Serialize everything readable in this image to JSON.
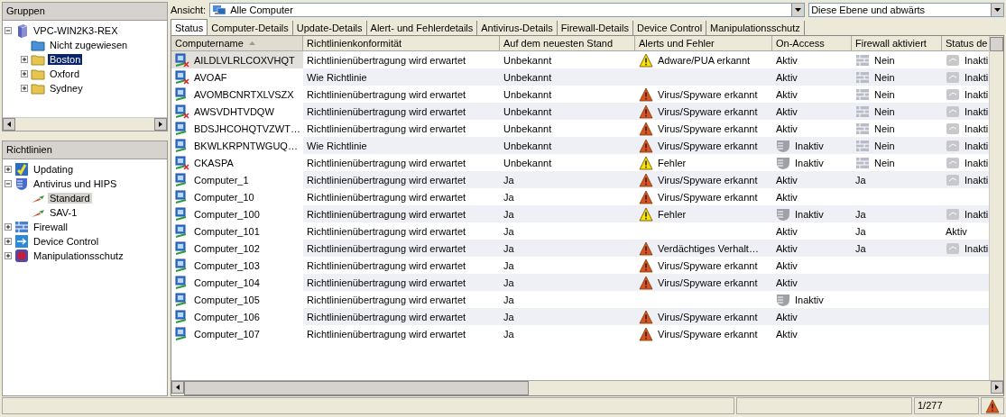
{
  "groups_panel": {
    "title": "Gruppen",
    "tree": [
      {
        "label": "VPC-WIN2K3-REX",
        "kind": "server",
        "expanded": true,
        "selected": false,
        "children": [
          {
            "label": "Nicht zugewiesen",
            "kind": "folder_blue",
            "selected": false
          },
          {
            "label": "Boston",
            "kind": "folder",
            "expanded": false,
            "selected": true
          },
          {
            "label": "Oxford",
            "kind": "folder",
            "expanded": false,
            "selected": false
          },
          {
            "label": "Sydney",
            "kind": "folder",
            "expanded": false,
            "selected": false
          }
        ]
      }
    ]
  },
  "policies_panel": {
    "title": "Richtlinien",
    "tree": [
      {
        "label": "Updating",
        "kind": "updating",
        "expanded": false,
        "selected": false
      },
      {
        "label": "Antivirus und HIPS",
        "kind": "antivirus",
        "expanded": true,
        "selected": false,
        "children": [
          {
            "label": "Standard",
            "kind": "policy",
            "selected": true
          },
          {
            "label": "SAV-1",
            "kind": "policy",
            "selected": false
          }
        ]
      },
      {
        "label": "Firewall",
        "kind": "firewall",
        "expanded": false,
        "selected": false
      },
      {
        "label": "Device Control",
        "kind": "device",
        "expanded": false,
        "selected": false
      },
      {
        "label": "Manipulationsschutz",
        "kind": "tamper",
        "expanded": false,
        "selected": false
      }
    ]
  },
  "toolbar": {
    "view_label": "Ansicht:",
    "view_value": "Alle Computer",
    "scope_value": "Diese Ebene und abwärts"
  },
  "tabs": [
    {
      "label": "Status",
      "selected": true
    },
    {
      "label": "Computer-Details",
      "selected": false
    },
    {
      "label": "Update-Details",
      "selected": false
    },
    {
      "label": "Alert- und Fehlerdetails",
      "selected": false
    },
    {
      "label": "Antivirus-Details",
      "selected": false
    },
    {
      "label": "Firewall-Details",
      "selected": false
    },
    {
      "label": "Device Control",
      "selected": false
    },
    {
      "label": "Manipulationsschutz",
      "selected": false
    }
  ],
  "table": {
    "columns": [
      {
        "label": "Computername",
        "sorted": true
      },
      {
        "label": "Richtlinienkonformität",
        "sorted": false
      },
      {
        "label": "Auf dem neuesten Stand",
        "sorted": false
      },
      {
        "label": "Alerts und Fehler",
        "sorted": false
      },
      {
        "label": "On-Access",
        "sorted": false
      },
      {
        "label": "Firewall aktiviert",
        "sorted": false
      },
      {
        "label": "Status de",
        "sorted": false
      }
    ],
    "rows": [
      {
        "name": "AILDLVLRLCOXVHQT",
        "offline": true,
        "selected": true,
        "compliance": "Richtlinienübertragung wird erwartet",
        "up_to_date": "Unbekannt",
        "alert": {
          "kind": "warning",
          "label": "Adware/PUA erkannt"
        },
        "on_access": "Aktiv",
        "on_access_inactive": false,
        "firewall": "Nein",
        "firewall_off": true,
        "status": "Inakti",
        "status_icon": true
      },
      {
        "name": "AVOAF",
        "offline": true,
        "selected": false,
        "compliance": "Wie Richtlinie",
        "up_to_date": "Unbekannt",
        "on_access": "Aktiv",
        "on_access_inactive": false,
        "firewall": "Nein",
        "firewall_off": true,
        "status": "Inakti",
        "status_icon": true
      },
      {
        "name": "AVOMBCNRTXLVSZX",
        "offline": false,
        "selected": false,
        "compliance": "Richtlinienübertragung wird erwartet",
        "up_to_date": "Unbekannt",
        "alert": {
          "kind": "danger",
          "label": "Virus/Spyware erkannt"
        },
        "on_access": "Aktiv",
        "on_access_inactive": false,
        "firewall": "Nein",
        "firewall_off": true,
        "status": "Inakti",
        "status_icon": true
      },
      {
        "name": "AWSVDHTVDQW",
        "offline": true,
        "selected": false,
        "compliance": "Richtlinienübertragung wird erwartet",
        "up_to_date": "Unbekannt",
        "alert": {
          "kind": "danger",
          "label": "Virus/Spyware erkannt"
        },
        "on_access": "Aktiv",
        "on_access_inactive": false,
        "firewall": "Nein",
        "firewall_off": true,
        "status": "Inakti",
        "status_icon": true
      },
      {
        "name": "BDSJHCOHQTVZWT…",
        "offline": false,
        "selected": false,
        "compliance": "Richtlinienübertragung wird erwartet",
        "up_to_date": "Unbekannt",
        "alert": {
          "kind": "danger",
          "label": "Virus/Spyware erkannt"
        },
        "on_access": "Aktiv",
        "on_access_inactive": false,
        "firewall": "Nein",
        "firewall_off": true,
        "status": "Inakti",
        "status_icon": true
      },
      {
        "name": "BKWLKRPNTWGUQ…",
        "offline": false,
        "selected": false,
        "compliance": "Wie Richtlinie",
        "up_to_date": "Unbekannt",
        "alert": {
          "kind": "danger",
          "label": "Virus/Spyware erkannt"
        },
        "on_access": "Inaktiv",
        "on_access_inactive": true,
        "firewall": "Nein",
        "firewall_off": true,
        "status": "Inakti",
        "status_icon": true
      },
      {
        "name": "CKASPA",
        "offline": true,
        "selected": false,
        "compliance": "Richtlinienübertragung wird erwartet",
        "up_to_date": "Unbekannt",
        "alert": {
          "kind": "warning",
          "label": "Fehler"
        },
        "on_access": "Inaktiv",
        "on_access_inactive": true,
        "firewall": "Nein",
        "firewall_off": true,
        "status": "Inakti",
        "status_icon": true
      },
      {
        "name": "Computer_1",
        "offline": false,
        "selected": false,
        "compliance": "Richtlinienübertragung wird erwartet",
        "up_to_date": "Ja",
        "alert": {
          "kind": "danger",
          "label": "Virus/Spyware erkannt"
        },
        "on_access": "Aktiv",
        "on_access_inactive": false,
        "firewall": "Ja",
        "firewall_off": false,
        "status": "Inakti",
        "status_icon": true
      },
      {
        "name": "Computer_10",
        "offline": false,
        "selected": false,
        "compliance": "Richtlinienübertragung wird erwartet",
        "up_to_date": "Ja",
        "alert": {
          "kind": "danger",
          "label": "Virus/Spyware erkannt"
        },
        "on_access": "Aktiv",
        "on_access_inactive": false,
        "firewall_off": false,
        "status_icon": false
      },
      {
        "name": "Computer_100",
        "offline": false,
        "selected": false,
        "compliance": "Richtlinienübertragung wird erwartet",
        "up_to_date": "Ja",
        "alert": {
          "kind": "warning",
          "label": "Fehler"
        },
        "on_access": "Inaktiv",
        "on_access_inactive": true,
        "firewall": "Ja",
        "firewall_off": false,
        "status": "Inakti",
        "status_icon": true
      },
      {
        "name": "Computer_101",
        "offline": false,
        "selected": false,
        "compliance": "Richtlinienübertragung wird erwartet",
        "up_to_date": "Ja",
        "on_access": "Aktiv",
        "on_access_inactive": false,
        "firewall": "Ja",
        "firewall_off": false,
        "status": "Aktiv",
        "status_icon": false
      },
      {
        "name": "Computer_102",
        "offline": false,
        "selected": false,
        "compliance": "Richtlinienübertragung wird erwartet",
        "up_to_date": "Ja",
        "alert": {
          "kind": "danger",
          "label": "Verdächtiges Verhalt…"
        },
        "on_access": "Aktiv",
        "on_access_inactive": false,
        "firewall": "Ja",
        "firewall_off": false,
        "status": "Inakti",
        "status_icon": true
      },
      {
        "name": "Computer_103",
        "offline": false,
        "selected": false,
        "compliance": "Richtlinienübertragung wird erwartet",
        "up_to_date": "Ja",
        "alert": {
          "kind": "danger",
          "label": "Virus/Spyware erkannt"
        },
        "on_access": "Aktiv",
        "on_access_inactive": false,
        "firewall_off": false,
        "status_icon": false
      },
      {
        "name": "Computer_104",
        "offline": false,
        "selected": false,
        "compliance": "Richtlinienübertragung wird erwartet",
        "up_to_date": "Ja",
        "alert": {
          "kind": "danger",
          "label": "Virus/Spyware erkannt"
        },
        "on_access": "Aktiv",
        "on_access_inactive": false,
        "firewall_off": false,
        "status_icon": false
      },
      {
        "name": "Computer_105",
        "offline": false,
        "selected": false,
        "compliance": "Richtlinienübertragung wird erwartet",
        "up_to_date": "Ja",
        "on_access": "Inaktiv",
        "on_access_inactive": true,
        "firewall_off": false,
        "status_icon": false
      },
      {
        "name": "Computer_106",
        "offline": false,
        "selected": false,
        "compliance": "Richtlinienübertragung wird erwartet",
        "up_to_date": "Ja",
        "alert": {
          "kind": "danger",
          "label": "Virus/Spyware erkannt"
        },
        "on_access": "Aktiv",
        "on_access_inactive": false,
        "firewall_off": false,
        "status_icon": false
      },
      {
        "name": "Computer_107",
        "offline": false,
        "selected": false,
        "compliance": "Richtlinienübertragung wird erwartet",
        "up_to_date": "Ja",
        "alert": {
          "kind": "danger",
          "label": "Virus/Spyware erkannt"
        },
        "on_access": "Aktiv",
        "on_access_inactive": false,
        "firewall_off": false,
        "status_icon": false
      }
    ]
  },
  "status_bar": {
    "count": "1/277"
  }
}
